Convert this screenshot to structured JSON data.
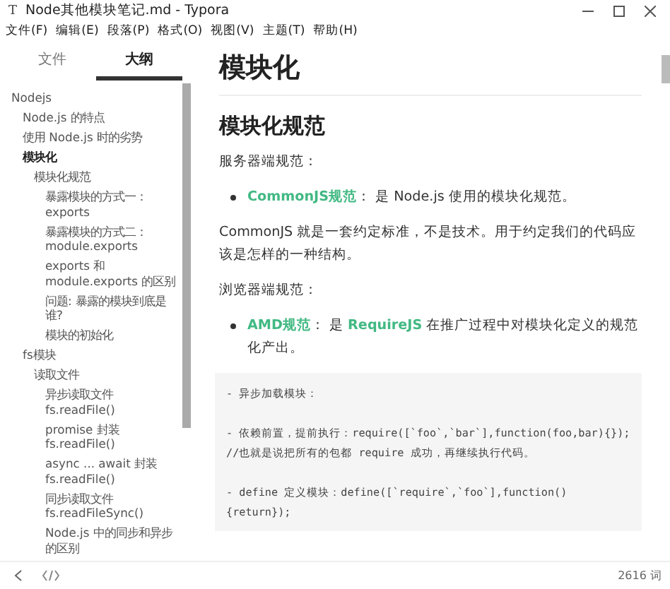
{
  "window": {
    "app_icon": "T",
    "title": "Node其他模块笔记.md - Typora"
  },
  "menu": [
    "文件(F)",
    "编辑(E)",
    "段落(P)",
    "格式(O)",
    "视图(V)",
    "主题(T)",
    "帮助(H)"
  ],
  "sidebar": {
    "tabs": [
      {
        "label": "文件",
        "selected": false
      },
      {
        "label": "大纲",
        "selected": true
      }
    ],
    "outline": [
      {
        "label": "Nodejs",
        "selected": false,
        "children": [
          {
            "label": "Node.js 的特点",
            "selected": false
          },
          {
            "label": "使用 Node.js 时的劣势",
            "selected": false
          },
          {
            "label": "模块化",
            "selected": true,
            "children": [
              {
                "label": "模块化规范",
                "selected": false,
                "children": [
                  {
                    "label": "暴露模块的方式一：exports",
                    "selected": false
                  },
                  {
                    "label": "暴露模块的方式二：module.exports",
                    "selected": false
                  },
                  {
                    "label": "exports 和 module.exports 的区别",
                    "selected": false
                  },
                  {
                    "label": "问题: 暴露的模块到底是谁?",
                    "selected": false
                  },
                  {
                    "label": "模块的初始化",
                    "selected": false
                  }
                ]
              }
            ]
          },
          {
            "label": "fs模块",
            "selected": false,
            "children": [
              {
                "label": "读取文件",
                "selected": false,
                "children": [
                  {
                    "label": "异步读取文件 fs.readFile()",
                    "selected": false
                  },
                  {
                    "label": "promise 封装 fs.readFile()",
                    "selected": false
                  },
                  {
                    "label": "async ... await 封装 fs.readFile()",
                    "selected": false
                  },
                  {
                    "label": "同步读取文件 fs.readFileSync()",
                    "selected": false
                  },
                  {
                    "label": "Node.js 中的同步和异步的区别",
                    "selected": false
                  }
                ]
              }
            ]
          }
        ]
      }
    ]
  },
  "document": {
    "blocks": [
      {
        "kind": "h1",
        "text": "模块化"
      },
      {
        "kind": "h2",
        "text": "模块化规范"
      },
      {
        "kind": "p",
        "text": "服务器端规范："
      },
      {
        "kind": "bullet",
        "parts": [
          {
            "kind": "term",
            "text": "CommonJS规范"
          },
          {
            "kind": "plain",
            "text": "： 是 Node.js 使用的模块化规范。"
          }
        ]
      },
      {
        "kind": "p",
        "text": "CommonJS 就是一套约定标准，不是技术。用于约定我们的代码应该是怎样的一种结构。"
      },
      {
        "kind": "p",
        "text": "浏览器端规范："
      },
      {
        "kind": "bullet",
        "parts": [
          {
            "kind": "term",
            "text": "AMD规范"
          },
          {
            "kind": "plain",
            "text": "： 是 "
          },
          {
            "kind": "term",
            "text": "RequireJS"
          },
          {
            "kind": "plain",
            "text": " 在推广过程中对模块化定义的规范化产出。"
          }
        ]
      },
      {
        "kind": "code",
        "lines": [
          "- 异步加载模块：",
          "- 依赖前置，提前执行：require([`foo`,`bar`],function(foo,bar){});   //也就是说把所有的包都 require 成功，再继续执行代码。",
          "- define 定义模块：define([`require`,`foo`],function(){return});"
        ]
      }
    ]
  },
  "status_bar": {
    "word_count": "2616 词"
  }
}
